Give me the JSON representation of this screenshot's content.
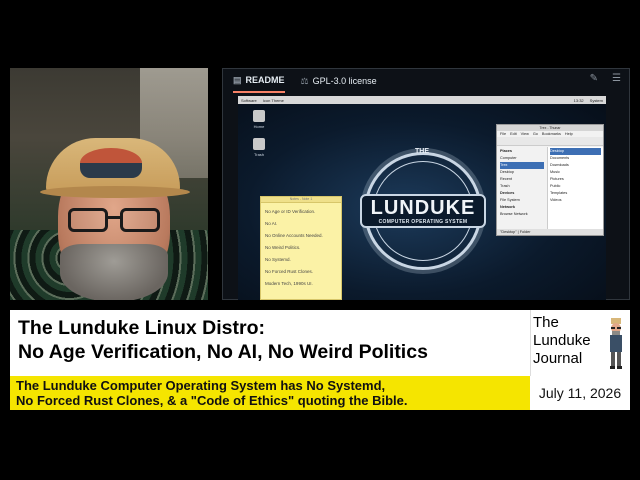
{
  "repo": {
    "tabs": [
      {
        "label": "README",
        "icon": "book-icon",
        "active": true
      },
      {
        "label": "GPL-3.0 license",
        "icon": "scale-icon",
        "active": false
      }
    ]
  },
  "desktop": {
    "topbar": {
      "menu": "Software",
      "window": "Icon Theme",
      "clock": "13:32",
      "system": "System"
    },
    "icons": [
      {
        "label": "Home"
      },
      {
        "label": "Trash"
      }
    ],
    "logo": {
      "the": "THE",
      "word": "LUNDUKE",
      "sub": "COMPUTER OPERATING SYSTEM"
    },
    "sticky": {
      "title": "Notes - Note 1",
      "items": [
        "No Age or ID Verification.",
        "No AI.",
        "No Online Accounts Needed.",
        "No Weird Politics.",
        "No Systemd.",
        "No Forced Rust Clones.",
        "Modern Tech, 1990s UI."
      ]
    },
    "file_manager": {
      "title": "Trex - Thunar",
      "menu": [
        "File",
        "Edit",
        "View",
        "Go",
        "Bookmarks",
        "Help"
      ],
      "side": [
        {
          "label": "Places",
          "header": true
        },
        {
          "label": "Computer"
        },
        {
          "label": "Trex",
          "selected": true
        },
        {
          "label": "Desktop"
        },
        {
          "label": "Recent"
        },
        {
          "label": "Trash"
        },
        {
          "label": "Devices",
          "header": true
        },
        {
          "label": "File System"
        },
        {
          "label": "Network",
          "header": true
        },
        {
          "label": "Browse Network"
        }
      ],
      "main": [
        {
          "label": "Desktop",
          "selected": true
        },
        {
          "label": "Documents"
        },
        {
          "label": "Downloads"
        },
        {
          "label": "Music"
        },
        {
          "label": "Pictures"
        },
        {
          "label": "Public"
        },
        {
          "label": "Templates"
        },
        {
          "label": "Videos"
        }
      ],
      "status": "\"Desktop\" | Folder"
    }
  },
  "headline": {
    "line1": "The Lunduke Linux Distro:",
    "line2": "No Age Verification, No AI, No Weird Politics"
  },
  "subheadline": {
    "line1": "The Lunduke Computer Operating System has No Systemd,",
    "line2": "No Forced Rust Clones, & a \"Code of Ethics\" quoting the Bible."
  },
  "brand": {
    "line1": "The",
    "line2": "Lunduke",
    "line3": "Journal"
  },
  "date": "July 11, 2026",
  "colors": {
    "yellow": "#f5e500",
    "github_bg": "#0d1117",
    "tab_accent": "#f78166"
  }
}
